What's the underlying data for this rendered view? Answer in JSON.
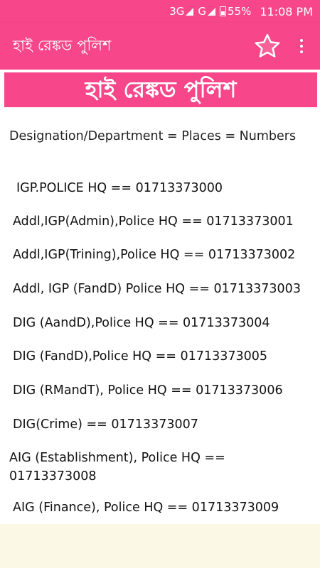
{
  "status_bar": {
    "network1": "3G",
    "network2": "G",
    "battery": "55%",
    "time": "11:08 PM"
  },
  "app_bar": {
    "title": "হাই রেঙ্কড পুলিশ",
    "favorite_icon": "star-outline-icon",
    "menu_icon": "more-vert-icon"
  },
  "content": {
    "banner": "হাই রেঙ্কড পুলিশ",
    "subtitle": "Designation/Department = Places = Numbers",
    "entries": [
      "IGP.POLICE HQ == 01713373000",
      "Addl,IGP(Admin),Police HQ == 01713373001",
      "Addl,IGP(Trining),Police HQ == 01713373002",
      "Addl, IGP (FandD) Police HQ == 01713373003",
      "DIG (AandD),Police HQ == 01713373004",
      "DIG (FandD),Police HQ == 01713373005",
      "DIG (RMandT), Police HQ == 01713373006",
      "DIG(Crime) == 01713373007",
      "AIG (Establishment), Police HQ ==\n01713373008",
      "AIG (Finance), Police HQ == 01713373009"
    ]
  },
  "colors": {
    "primary": "#f7478a",
    "background_bottom": "#fbf8e6"
  }
}
